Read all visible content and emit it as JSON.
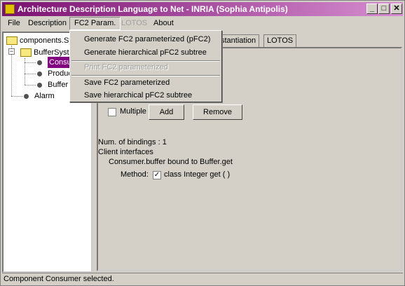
{
  "window": {
    "title": "Architecture Description Language to Net  -  INRIA (Sophia Antipolis)",
    "minimize": "_",
    "maximize": "□",
    "close": "✕"
  },
  "menubar": {
    "items": [
      "File",
      "Description",
      "FC2 Param.",
      "LOTOS",
      "About"
    ]
  },
  "dropdown": {
    "items": [
      "Generate FC2 parameterized (pFC2)",
      "Generate hierarchical pFC2 subtree",
      "Print FC2 parameterized",
      "Save FC2 parameterized",
      "Save hierarchical pFC2 subtree"
    ]
  },
  "tree": {
    "root": "components.Sy",
    "buffer_system": "BufferSyst",
    "consumer": "Consur",
    "producer": "Produc",
    "buffer": "Buffer",
    "alarm": "Alarm"
  },
  "tabs": [
    "stantiation",
    "LOTOS"
  ],
  "controls": {
    "multiple_label": "Multiple",
    "add": "Add",
    "remove": "Remove"
  },
  "bindings": {
    "num_label": "Num. of bindings :  1",
    "client_interfaces": "Client interfaces",
    "binding": "Consumer.buffer bound to Buffer.get",
    "method_label": "Method:",
    "method_value": "class Integer get  ( )",
    "checkmark": "✓"
  },
  "status": "Component Consumer selected.",
  "colors": {
    "accent": "#800080",
    "title_start": "#7a1070",
    "title_end": "#d68fd0"
  }
}
